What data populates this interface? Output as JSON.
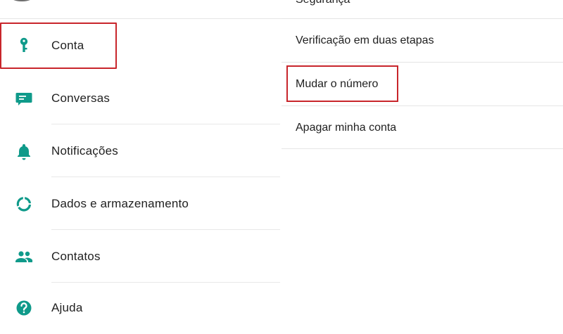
{
  "left_menu": {
    "items": [
      {
        "label": "Conta",
        "icon": "key-icon"
      },
      {
        "label": "Conversas",
        "icon": "chat-icon"
      },
      {
        "label": "Notificações",
        "icon": "bell-icon"
      },
      {
        "label": "Dados e armazenamento",
        "icon": "data-usage-icon"
      },
      {
        "label": "Contatos",
        "icon": "contacts-icon"
      },
      {
        "label": "Ajuda",
        "icon": "help-icon"
      }
    ]
  },
  "right_menu": {
    "partial_top_label": "Segurança",
    "items": [
      {
        "label": "Verificação em duas etapas"
      },
      {
        "label": "Mudar o número"
      },
      {
        "label": "Apagar minha conta"
      }
    ]
  },
  "colors": {
    "icon_teal": "#0f9a8a",
    "highlight_red": "#c8252b"
  }
}
